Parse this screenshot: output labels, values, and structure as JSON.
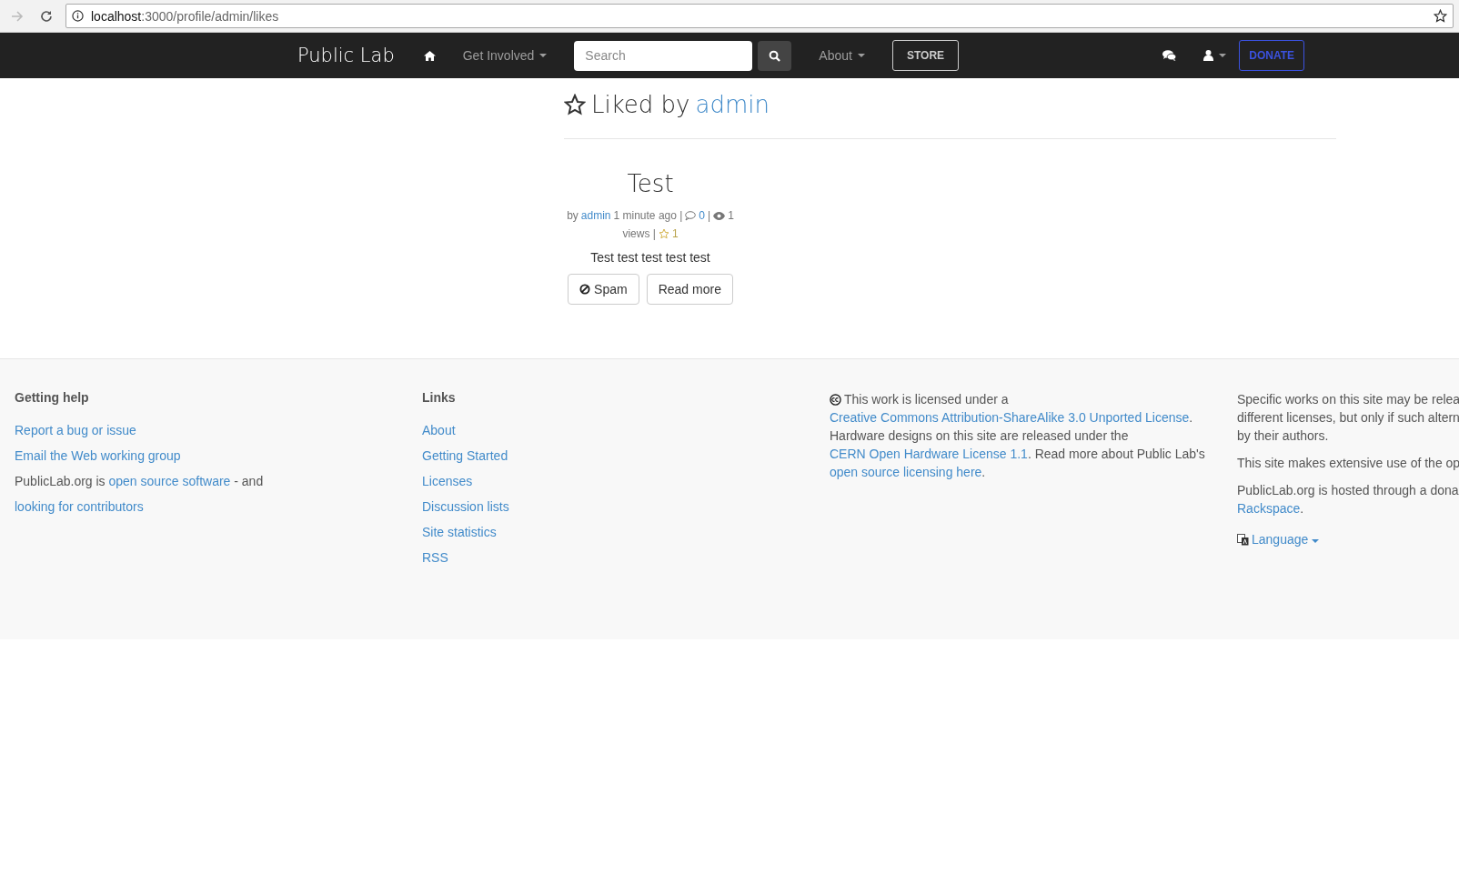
{
  "browser": {
    "url_host": "localhost",
    "url_path": ":3000/profile/admin/likes"
  },
  "navbar": {
    "brand": "Public Lab",
    "items": [
      {
        "kind": "home"
      },
      {
        "kind": "dropdown",
        "label": "Get Involved"
      },
      {
        "kind": "search",
        "placeholder": "Search"
      },
      {
        "kind": "dropdown",
        "label": "About"
      },
      {
        "kind": "outline",
        "label": "STORE"
      }
    ],
    "right": [
      {
        "kind": "chat"
      },
      {
        "kind": "user"
      },
      {
        "kind": "donate",
        "label": "DONATE"
      }
    ]
  },
  "heading": {
    "prefix": "Liked by",
    "user": "admin"
  },
  "posts": [
    {
      "title": "Test",
      "meta": [
        {
          "kind": "text",
          "text": "by"
        },
        {
          "kind": "link",
          "text": "admin"
        },
        {
          "kind": "text",
          "text": "1 minute ago |"
        },
        {
          "kind": "comment_icon"
        },
        {
          "kind": "link",
          "text": "0"
        },
        {
          "kind": "text",
          "text": "|"
        },
        {
          "kind": "eye_icon"
        },
        {
          "kind": "text",
          "text": "1"
        },
        {
          "kind": "text",
          "text": "views |"
        },
        {
          "kind": "star_icon"
        },
        {
          "kind": "likes",
          "text": "1"
        }
      ],
      "body": "Test test test test test",
      "buttons": [
        {
          "kind": "spam",
          "label": "Spam"
        },
        {
          "kind": "plain",
          "label": "Read more"
        }
      ]
    }
  ],
  "footer": {
    "columns": [
      {
        "heading": "Getting help",
        "links": [
          "Report a bug or issue",
          "Email the Web working group"
        ],
        "paragraphs": [
          [
            {
              "text": "PublicLab.org is ",
              "kind": "text"
            },
            {
              "text": "open source software",
              "kind": "link"
            },
            {
              "text": " - and ",
              "kind": "text"
            },
            {
              "text": "looking for contributors",
              "kind": "link"
            }
          ]
        ]
      },
      {
        "heading": "Links",
        "links": [
          "About",
          "Getting Started",
          "Licenses",
          "Discussion lists",
          "Site statistics",
          "RSS"
        ]
      },
      {
        "paragraphs": [
          [
            {
              "text": "This work is licensed under a ",
              "kind": "text"
            },
            {
              "text": "Creative Commons Attribution-ShareAlike 3.0 Unported License",
              "kind": "link"
            },
            {
              "text": ". Hardware designs on this site are released under the ",
              "kind": "text"
            },
            {
              "text": "CERN Open Hardware License 1.1",
              "kind": "link"
            },
            {
              "text": ". Read more about Public Lab's ",
              "kind": "text"
            },
            {
              "text": "open source licensing here",
              "kind": "link"
            },
            {
              "text": ".",
              "kind": "text"
            }
          ]
        ]
      },
      {
        "lines": [
          [
            "Specific works on this site may be relea"
          ],
          [
            "different licenses, but only if such altern"
          ],
          [
            "by their authors."
          ]
        ],
        "more": [
          [
            [
              {
                "text": "This site makes extensive use of the op",
                "kind": "text"
              }
            ]
          ],
          [
            [
              {
                "text": "PublicLab.org is hosted through a dona",
                "kind": "text"
              }
            ],
            [
              {
                "text": "Rackspace",
                "kind": "link"
              },
              {
                "text": ".",
                "kind": "text"
              }
            ]
          ]
        ],
        "language": "Language"
      }
    ]
  }
}
